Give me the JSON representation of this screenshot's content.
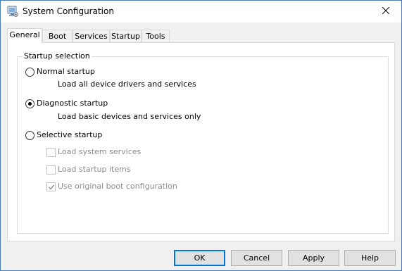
{
  "window": {
    "title": "System Configuration",
    "icon": "msconfig-icon",
    "close_icon": "close-icon"
  },
  "tabs": [
    {
      "label": "General",
      "active": true
    },
    {
      "label": "Boot",
      "active": false
    },
    {
      "label": "Services",
      "active": false
    },
    {
      "label": "Startup",
      "active": false
    },
    {
      "label": "Tools",
      "active": false
    }
  ],
  "startup_selection": {
    "group_label": "Startup selection",
    "normal": {
      "label": "Normal startup",
      "description": "Load all device drivers and services",
      "selected": false
    },
    "diagnostic": {
      "label": "Diagnostic startup",
      "description": "Load basic devices and services only",
      "selected": true
    },
    "selective": {
      "label": "Selective startup",
      "selected": false,
      "options": [
        {
          "label": "Load system services",
          "checked": false,
          "enabled": false
        },
        {
          "label": "Load startup items",
          "checked": false,
          "enabled": false
        },
        {
          "label": "Use original boot configuration",
          "checked": true,
          "enabled": false
        }
      ]
    }
  },
  "buttons": {
    "ok": "OK",
    "cancel": "Cancel",
    "apply": "Apply",
    "help": "Help"
  }
}
